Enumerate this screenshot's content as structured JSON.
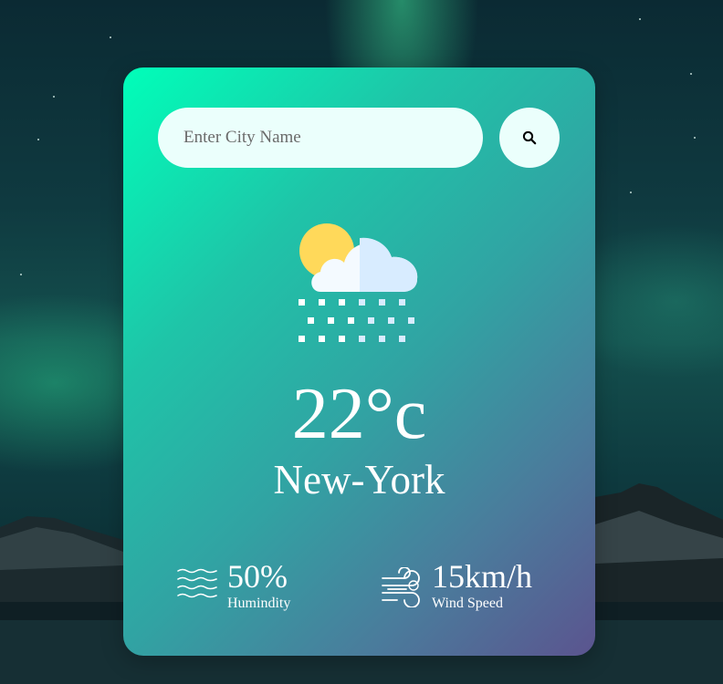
{
  "search": {
    "placeholder": "Enter City Name",
    "value": "",
    "button_icon": "search-icon"
  },
  "weather": {
    "icon": "snow-cloud-sun-icon",
    "temperature": "22°c",
    "city": "New-York"
  },
  "details": {
    "humidity": {
      "icon": "humidity-waves-icon",
      "value": "50%",
      "label": "Humindity"
    },
    "wind": {
      "icon": "wind-icon",
      "value": "15km/h",
      "label": "Wind Speed"
    }
  },
  "colors": {
    "card_gradient_start": "#00ffb9",
    "card_gradient_end": "#5b548f",
    "input_background": "#ebfffc",
    "text": "#ffffff"
  }
}
